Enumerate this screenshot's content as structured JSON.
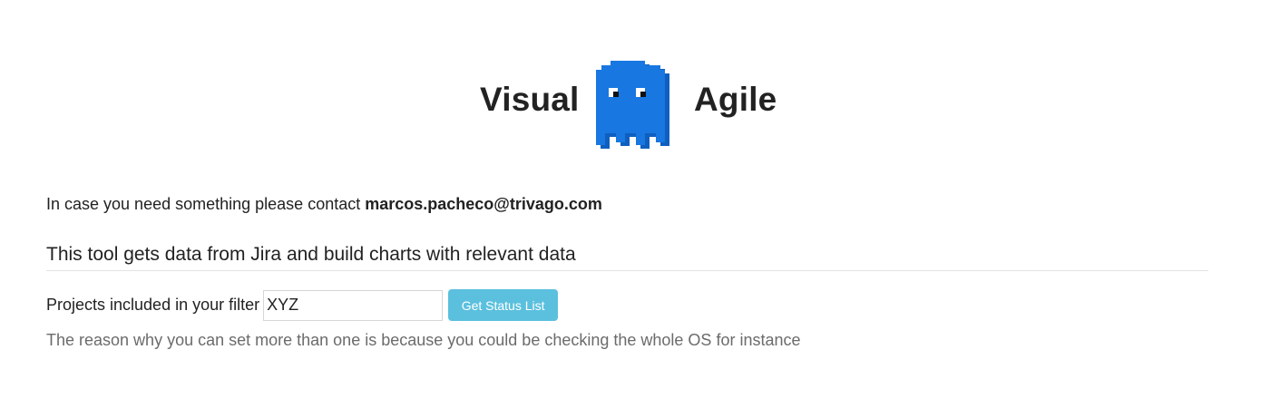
{
  "header": {
    "title_left": "Visual",
    "title_right": "Agile",
    "logo_icon": "ghost-icon",
    "logo_color": "#1877e0"
  },
  "contact": {
    "prefix": "In case you need something please contact ",
    "email": "marcos.pacheco@trivago.com"
  },
  "description": "This tool gets data from Jira and build charts with relevant data",
  "filter": {
    "label": "Projects included in your filter",
    "value": "XYZ",
    "button_label": "Get Status List",
    "button_color": "#5bc0de",
    "help_text": "The reason why you can set more than one is because you could be checking the whole OS for instance"
  }
}
